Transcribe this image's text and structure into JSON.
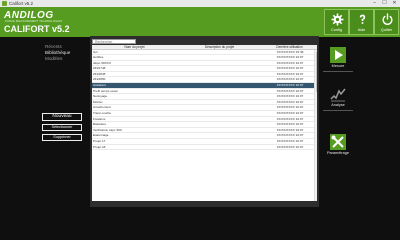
{
  "window": {
    "title": "Califort v5.2",
    "controls": [
      "–",
      "☐",
      "✕"
    ]
  },
  "header": {
    "brand": "ANDILOG",
    "tagline": "FORCE MEASUREMENT TECHNOLOGIES",
    "product": "CALIFORT v5.2",
    "buttons": [
      {
        "label": "Config",
        "icon": "gear-icon"
      },
      {
        "label": "Aide",
        "icon": "help-icon"
      },
      {
        "label": "Quitter",
        "icon": "power-icon"
      }
    ]
  },
  "sidebar": {
    "items": [
      {
        "label": "Récents",
        "active": false
      },
      {
        "label": "Bibliothèque",
        "active": true
      },
      {
        "label": "Modèles",
        "active": false
      }
    ]
  },
  "left_buttons": {
    "new": "Nouveau",
    "select": "Sélectionner",
    "delete": "Supprimer"
  },
  "search": {
    "placeholder": "Rechercher"
  },
  "table": {
    "headers": [
      "Nom du projet",
      "Description du projet",
      "Dernière utilisation"
    ],
    "rows": [
      [
        "Sol",
        "",
        "XX/XX/XXXX 15:48"
      ],
      [
        "lentilles",
        "",
        "XX/XX/XXXX 16:07"
      ],
      [
        "dispo 58XXX",
        "",
        "XX/XX/XXXX 16:07"
      ],
      [
        "ZF22748",
        "",
        "XX/XX/XXXX 16:07"
      ],
      [
        "ZF22848",
        "",
        "XX/XX/XXXX 16:07"
      ],
      [
        "ZF22850",
        "",
        "XX/XX/XXXX 16:07"
      ],
      [
        "Assistant",
        "",
        "XX/XX/XXXX 16:07"
      ],
      [
        "Profil temps essai",
        "",
        "XX/XX/XXXX 16:07"
      ],
      [
        "Nettoyage",
        "",
        "XX/XX/XXXX 16:07"
      ],
      [
        "Mortier",
        "",
        "XX/XX/XXXX 16:07"
      ],
      [
        "Arrachement",
        "",
        "XX/XX/XXXX 16:07"
      ],
      [
        "Tracé courbe",
        "",
        "XX/XX/XXXX 16:07"
      ],
      [
        "Fixations",
        "",
        "XX/XX/XXXX 16:07"
      ],
      [
        "Bastidore",
        "",
        "XX/XX/XXXX 16:07"
      ],
      [
        "Verification capt. 500",
        "",
        "XX/XX/XXXX 16:07"
      ],
      [
        "Etalonnage",
        "",
        "XX/XX/XXXX 16:07"
      ],
      [
        "Projet 17",
        "",
        "XX/XX/XXXX 16:07"
      ],
      [
        "Projet 18",
        "",
        "XX/XX/XXXX 16:07"
      ]
    ],
    "selected_index": 6
  },
  "right_actions": [
    {
      "label": "Mesure",
      "icon": "play-icon"
    },
    {
      "label": "Analyse",
      "icon": "chart-icon"
    },
    {
      "label": "Paramétrage",
      "icon": "tools-icon"
    }
  ],
  "colors": {
    "brand_green": "#569c20",
    "selection": "#34566e",
    "background": "#0f0f0f"
  }
}
